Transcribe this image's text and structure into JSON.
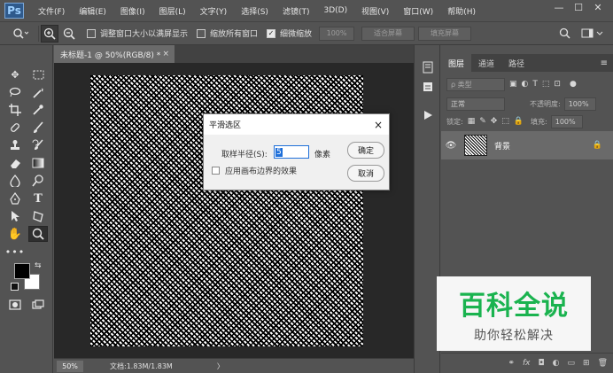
{
  "menubar": {
    "logo": "Ps",
    "items": [
      "文件(F)",
      "编辑(E)",
      "图像(I)",
      "图层(L)",
      "文字(Y)",
      "选择(S)",
      "滤镜(T)",
      "3D(D)",
      "视图(V)",
      "窗口(W)",
      "帮助(H)"
    ],
    "minimize": "—",
    "maximize": "☐",
    "close": "✕"
  },
  "options": {
    "resize_windows": "调整窗口大小以满屏显示",
    "zoom_all": "缩放所有窗口",
    "scrubby_zoom": "细微缩放",
    "zoom_value": "100%",
    "fit_screen": "适合屏幕",
    "fill_screen": "填充屏幕"
  },
  "document": {
    "tab_title": "未标题-1 @ 50%(RGB/8) *",
    "tab_close": "×"
  },
  "statusbar": {
    "zoom": "50%",
    "doc_info": "文档:1.83M/1.83M",
    "arrow": "〉"
  },
  "panel": {
    "tabs": [
      "图层",
      "通道",
      "路径"
    ],
    "menu_icon": "≡",
    "filter_kind": "ρ 类型",
    "blend_mode": "正常",
    "opacity_label": "不透明度:",
    "opacity_value": "100%",
    "lock_label": "锁定:",
    "fill_label": "填充:",
    "fill_value": "100%",
    "layer_name": "背景"
  },
  "dialog": {
    "title": "平滑选区",
    "close": "×",
    "radius_label": "取样半径(S):",
    "radius_value": "5",
    "unit": "像素",
    "apply_canvas_bounds": "应用画布边界的效果",
    "ok": "确定",
    "cancel": "取消"
  },
  "watermark": {
    "main": "百科全说",
    "sub": "助你轻松解决"
  },
  "colors": {
    "ui_gray": "#535353",
    "accent_blue": "#1e6fd9",
    "watermark_green": "#1ab34f"
  }
}
